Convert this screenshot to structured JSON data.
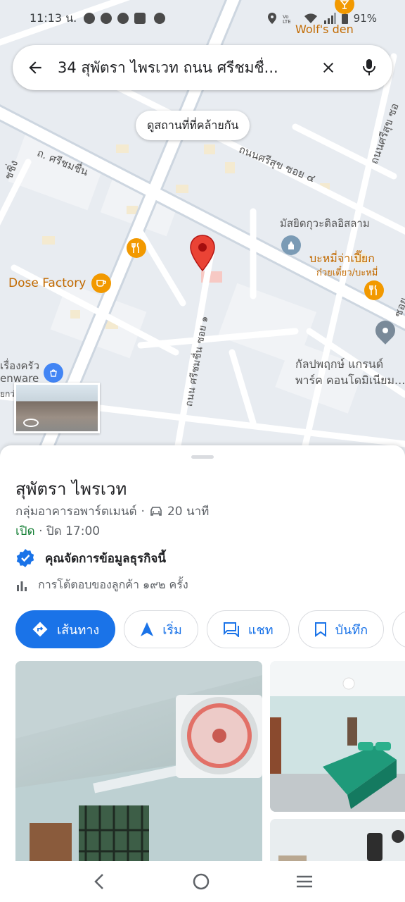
{
  "status_bar": {
    "time": "11:13 น.",
    "battery": "91%"
  },
  "search": {
    "query": "34 สุพัตรา ไพรเวท ถนน ศรีชมชื่...",
    "similar_places_label": "ดูสถานที่ที่คล้ายกัน"
  },
  "map": {
    "labels": {
      "wolfs_den": "Wolf's den",
      "road_srichomchuen": "ถ. ศรีชมชื่น",
      "road_srisuk_4": "ถนนศรีสุข ซอย ๔",
      "road_srisuk": "ถนนศรีสุข ซอ",
      "mosque": "มัสยิดกุวะติลอิสลาม",
      "noodle_name": "บะหมี่จ่าเปี๊ยก",
      "noodle_sub": "ก๋วยเตี๋ยว/บะหมี่",
      "dose_factory": "Dose Factory",
      "soi_1": "ถนน ศรีชมชื่น ซอย ๑",
      "condo_line1": "กัลปพฤกษ์ แกรนด์",
      "condo_line2": "พาร์ค คอนโดมิเนียม...",
      "kitchenware_line1": "เรื่องครัว",
      "kitchenware_line2": "enware",
      "left_road_fragment": "ชชิ่ง",
      "left_fragment_small": "ยกว่",
      "right_fragment": "ซอย"
    }
  },
  "place": {
    "name": "สุพัตรา ไพรเวท",
    "category": "กลุ่มอาคารอพาร์ตเมนต์",
    "drive_time": "20 นาที",
    "open_label": "เปิด",
    "close_time": "· ปิด 17:00",
    "claimed": "คุณจัดการข้อมูลธุรกิจนี้",
    "interactions": "การโต้ตอบของลูกค้า ๑๙๒ ครั้ง"
  },
  "actions": [
    {
      "label": "เส้นทาง"
    },
    {
      "label": "เริ่ม"
    },
    {
      "label": "แชท"
    },
    {
      "label": "บันทึก"
    }
  ],
  "colors": {
    "accent": "#1a73e8",
    "pin": "#ea4335",
    "poi_orange": "#f29900",
    "open_green": "#188038"
  }
}
